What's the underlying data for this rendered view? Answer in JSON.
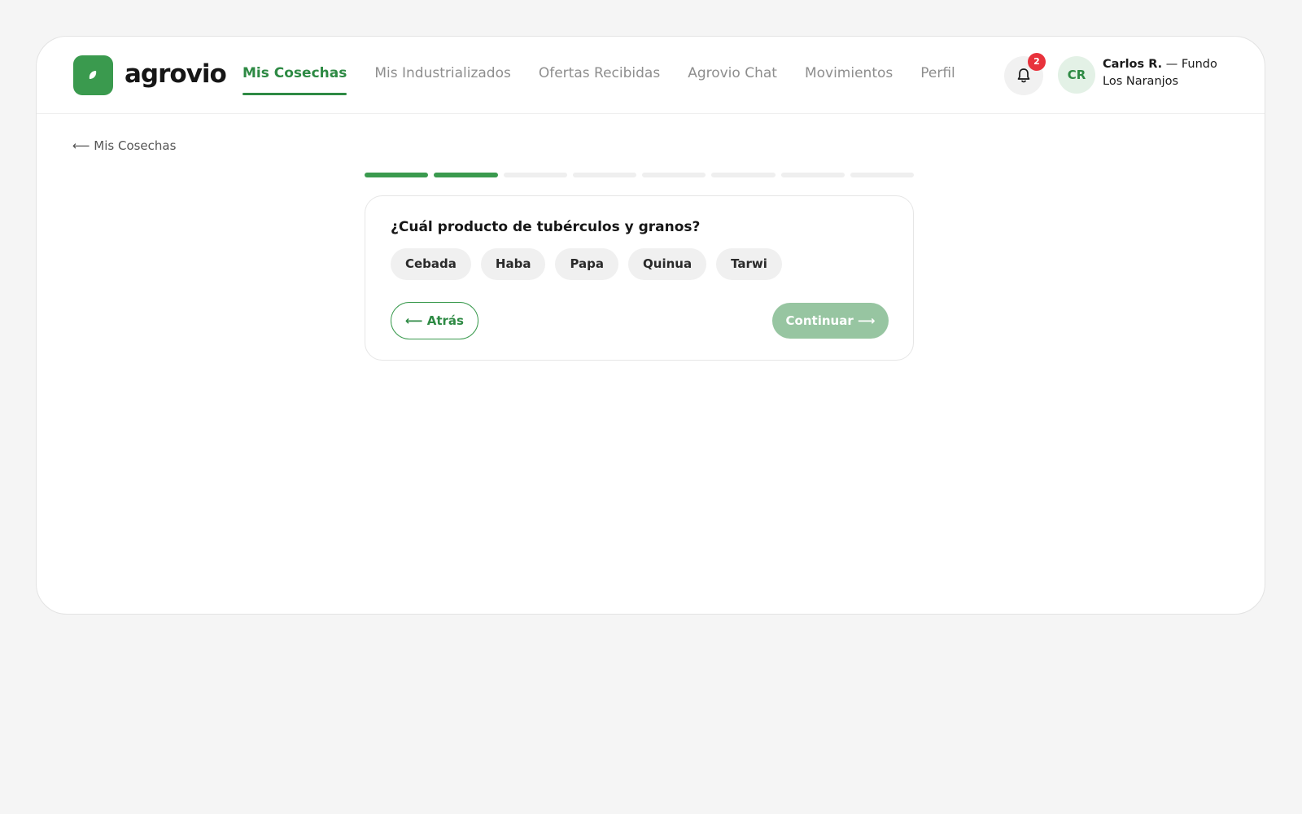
{
  "brand": {
    "name": "agrovio",
    "logo_icon": "leaf-icon",
    "accent_color": "#3a9a4e"
  },
  "nav": {
    "items": [
      {
        "label": "Mis Cosechas",
        "active": true
      },
      {
        "label": "Mis Industrializados",
        "active": false
      },
      {
        "label": "Ofertas Recibidas",
        "active": false
      },
      {
        "label": "Agrovio Chat",
        "active": false
      },
      {
        "label": "Movimientos",
        "active": false
      },
      {
        "label": "Perfil",
        "active": false
      }
    ]
  },
  "header": {
    "notifications": {
      "icon": "bell-icon",
      "count": "2"
    },
    "user": {
      "initials": "CR",
      "name": "Carlos R.",
      "separator": " — ",
      "farm": "Fundo Los Naranjos"
    }
  },
  "breadcrumb": {
    "back_label": "⟵ Mis Cosechas"
  },
  "wizard": {
    "total_steps": 8,
    "completed_steps": 2,
    "question": "¿Cuál producto de tubérculos y granos?",
    "options": [
      "Cebada",
      "Haba",
      "Papa",
      "Quinua",
      "Tarwi"
    ],
    "back_button": "⟵ Atrás",
    "continue_button": "Continuar ⟶",
    "continue_enabled": false
  }
}
